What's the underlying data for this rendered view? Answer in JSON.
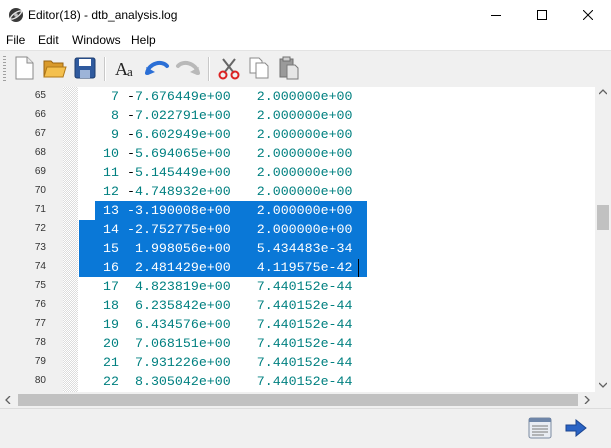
{
  "window": {
    "title": "Editor(18) - dtb_analysis.log",
    "minimize_icon": "minimize-icon",
    "maximize_icon": "maximize-icon",
    "close_icon": "close-icon"
  },
  "menu": [
    {
      "label": "File"
    },
    {
      "label": "Edit"
    },
    {
      "label": "Windows"
    },
    {
      "label": "Help"
    }
  ],
  "toolbar": {
    "buttons": [
      "new-file-icon",
      "open-folder-icon",
      "save-icon",
      "font-icon",
      "undo-icon",
      "redo-icon",
      "cut-icon",
      "copy-icon",
      "paste-icon"
    ]
  },
  "editor": {
    "lines": [
      {
        "ln": "65",
        "idx": "7",
        "val": "-7.676449e+00",
        "w": "2.000000e+00",
        "sel": false
      },
      {
        "ln": "66",
        "idx": "8",
        "val": "-7.022791e+00",
        "w": "2.000000e+00",
        "sel": false
      },
      {
        "ln": "67",
        "idx": "9",
        "val": "-6.602949e+00",
        "w": "2.000000e+00",
        "sel": false
      },
      {
        "ln": "68",
        "idx": "10",
        "val": "-5.694065e+00",
        "w": "2.000000e+00",
        "sel": false
      },
      {
        "ln": "69",
        "idx": "11",
        "val": "-5.145449e+00",
        "w": "2.000000e+00",
        "sel": false
      },
      {
        "ln": "70",
        "idx": "12",
        "val": "-4.748932e+00",
        "w": "2.000000e+00",
        "sel": false
      },
      {
        "ln": "71",
        "idx": "13",
        "val": "-3.190008e+00",
        "w": "2.000000e+00",
        "sel": true
      },
      {
        "ln": "72",
        "idx": "14",
        "val": "-2.752775e+00",
        "w": "2.000000e+00",
        "sel": true
      },
      {
        "ln": "73",
        "idx": "15",
        "val": " 1.998056e+00",
        "w": "5.434483e-34",
        "sel": true
      },
      {
        "ln": "74",
        "idx": "16",
        "val": " 2.481429e+00",
        "w": "4.119575e-42",
        "sel": true
      },
      {
        "ln": "75",
        "idx": "17",
        "val": " 4.823819e+00",
        "w": "7.440152e-44",
        "sel": false
      },
      {
        "ln": "76",
        "idx": "18",
        "val": " 6.235842e+00",
        "w": "7.440152e-44",
        "sel": false
      },
      {
        "ln": "77",
        "idx": "19",
        "val": " 6.434576e+00",
        "w": "7.440152e-44",
        "sel": false
      },
      {
        "ln": "78",
        "idx": "20",
        "val": " 7.068151e+00",
        "w": "7.440152e-44",
        "sel": false
      },
      {
        "ln": "79",
        "idx": "21",
        "val": " 7.931226e+00",
        "w": "7.440152e-44",
        "sel": false
      },
      {
        "ln": "80",
        "idx": "22",
        "val": " 8.305042e+00",
        "w": "7.440152e-44",
        "sel": false
      }
    ]
  },
  "colors": {
    "selection": "#0a78d7",
    "code_text": "#008080",
    "gutter": "#f0f0f0"
  },
  "bottom": {
    "buttons": [
      "log-view-icon",
      "next-arrow-icon"
    ]
  }
}
